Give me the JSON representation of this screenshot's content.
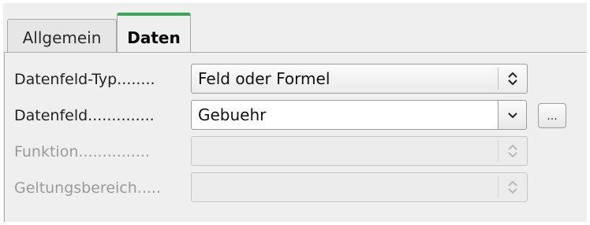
{
  "tabs": [
    {
      "label": "Allgemein",
      "active": false
    },
    {
      "label": "Daten",
      "active": true
    }
  ],
  "rows": [
    {
      "label": "Datenfeld-Typ........",
      "value": "Feld oder Formel",
      "enabled": true
    },
    {
      "label": "Datenfeld..............",
      "value": "Gebuehr",
      "enabled": true
    },
    {
      "label": "Funktion...............",
      "value": "",
      "enabled": false
    },
    {
      "label": "Geltungsbereich.....",
      "value": "",
      "enabled": false
    }
  ],
  "buttons": {
    "browse_label": "..."
  },
  "icons": {
    "spin": "up-down-arrows-icon",
    "combo": "chevron-down-icon"
  },
  "colors": {
    "active_tab_accent": "#3aa655",
    "disabled_text": "#9a9a9a"
  }
}
